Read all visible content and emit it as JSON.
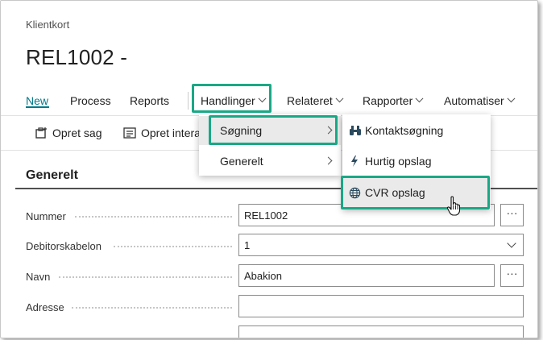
{
  "page": {
    "caption": "Klientkort",
    "title": "REL1002 -"
  },
  "actionbar": {
    "items": [
      {
        "label": "New"
      },
      {
        "label": "Process"
      },
      {
        "label": "Reports"
      },
      {
        "label": "Handlinger"
      },
      {
        "label": "Relateret"
      },
      {
        "label": "Rapporter"
      },
      {
        "label": "Automatiser"
      }
    ]
  },
  "promoted": {
    "items": [
      {
        "label": "Opret sag",
        "icon": "create-case-icon"
      },
      {
        "label": "Opret intera",
        "icon": "create-interaction-icon"
      }
    ]
  },
  "menu_handlinger": {
    "items": [
      {
        "label": "Søgning"
      },
      {
        "label": "Generelt"
      }
    ]
  },
  "menu_sogning": {
    "items": [
      {
        "label": "Kontaktsøgning",
        "icon": "binoculars-icon"
      },
      {
        "label": "Hurtig opslag",
        "icon": "lightning-icon"
      },
      {
        "label": "CVR opslag",
        "icon": "globe-icon"
      }
    ]
  },
  "section": {
    "title": "Generelt"
  },
  "fields": [
    {
      "label": "Nummer",
      "value": "REL1002",
      "lookup": "···"
    },
    {
      "label": "Debitorskabelon",
      "value": "1"
    },
    {
      "label": "Navn",
      "value": "Abakion",
      "lookup": "···"
    },
    {
      "label": "Adresse",
      "value": ""
    }
  ],
  "colors": {
    "accent": "#00788a",
    "highlight": "#1aa885"
  }
}
